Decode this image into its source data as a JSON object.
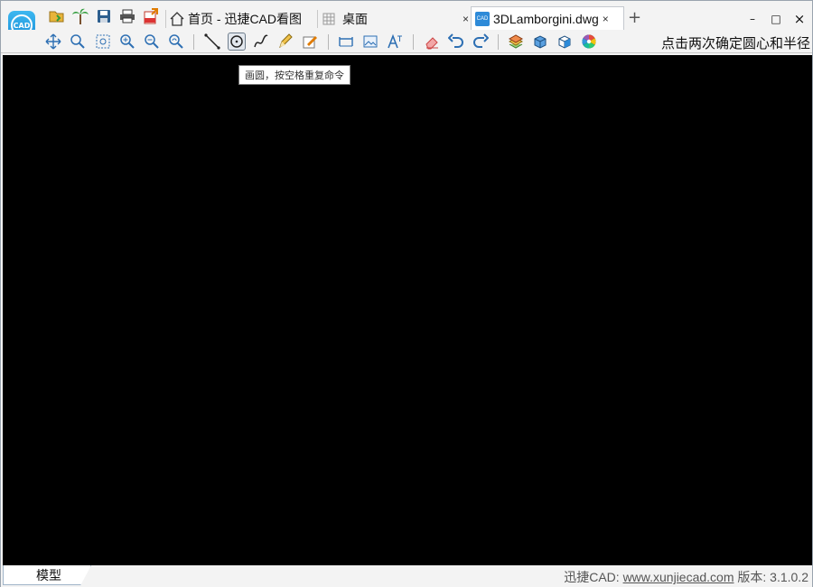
{
  "app": {
    "logo_text": "CAD"
  },
  "tabs": [
    {
      "label": "首页 - 迅捷CAD看图",
      "closable": false
    },
    {
      "label": "桌面",
      "closable": true
    },
    {
      "label": "3DLamborgini.dwg",
      "closable": true,
      "active": true
    }
  ],
  "tab_close_glyph": "×",
  "new_tab_glyph": "+",
  "window_controls": {
    "minimize": "–",
    "maximize": "□",
    "close": "×"
  },
  "toolbar": {
    "hint": "点击两次确定圆心和半径"
  },
  "tooltip": "画圆，按空格重复命令",
  "statusbar": {
    "model_tab": "模型",
    "brand": "迅捷CAD:",
    "url": "www.xunjiecad.com",
    "version_label": "版本:",
    "version": "3.1.0.2"
  },
  "colors": {
    "canvas": "#000000",
    "accent": "#1a8ed8"
  }
}
